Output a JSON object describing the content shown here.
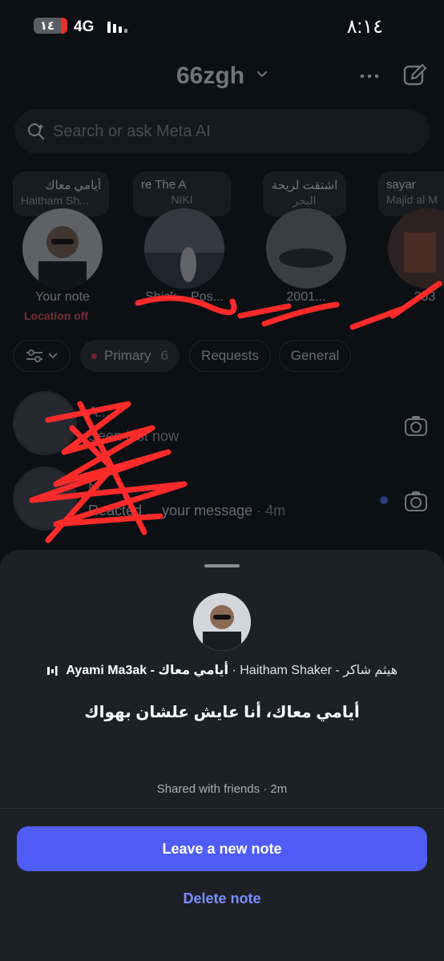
{
  "status_bar": {
    "battery_level": "١٤",
    "network": "4G",
    "time": "٨:١٤"
  },
  "header": {
    "account_name": "66zgh",
    "icons": [
      "chevron-down-icon",
      "more-horizontal-icon",
      "compose-icon"
    ]
  },
  "search": {
    "placeholder": "Search or ask Meta AI"
  },
  "notes": [
    {
      "line1": "أيامي معاك",
      "line2": "Haitham Sh...",
      "name": "Your note",
      "status": "Location off"
    },
    {
      "line1": "re   The A",
      "line2": "NIKI",
      "name": "Shick... Pos..."
    },
    {
      "line1": "اشتقت لريحة",
      "line2": "البحر",
      "name": "2001..."
    },
    {
      "line1": "sayar",
      "line2": "Majid al M",
      "name": "303"
    }
  ],
  "filters": {
    "primary_label": "Primary",
    "primary_count": "6",
    "requests_label": "Requests",
    "general_label": "General"
  },
  "threads": [
    {
      "name": "A...",
      "preview": "Seen just now"
    },
    {
      "name": "M...",
      "preview": "Reacted ... your message",
      "time": "4m"
    }
  ],
  "sheet": {
    "song_title": "Ayami Ma3ak - أيامي معاك",
    "artist": "Haitham Shaker - هيثم شاكر",
    "note_text": "أيامي معاك، أنا عايش علشان بهواك",
    "shared_info": "Shared with friends · 2m",
    "leave_note_label": "Leave a new note",
    "delete_note_label": "Delete note"
  },
  "colors": {
    "accent": "#4f5cf6",
    "link": "#7b8cff",
    "location_off": "#ff5d61",
    "unread": "#4f7dff",
    "scribble": "#ff2a2a"
  }
}
